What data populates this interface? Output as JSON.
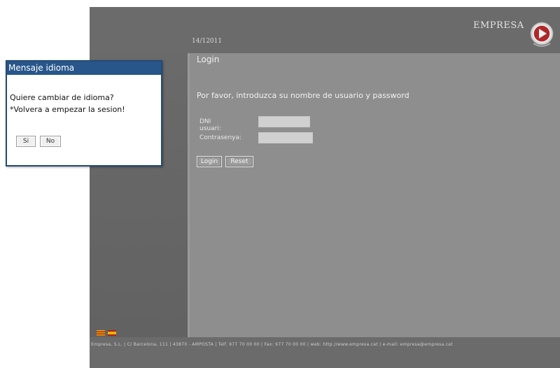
{
  "header": {
    "date": "14/12011",
    "brand": "EMPRESA"
  },
  "login": {
    "title": "Login",
    "instructions": "Por favor, introduzca su nombre de usuario y password",
    "user_label": "DNI usuari:",
    "user_value": "",
    "password_label": "Contrasenya:",
    "password_value": "",
    "login_button": "Login",
    "reset_button": "Reset"
  },
  "footer": {
    "text": "Empresa, S.L. | C/ Barcelona, 111 | 43870 - AMPOSTA | Telf. 977 70 00 00 | Fax: 977 70 00 00 | web: http://www.empresa.cat | e-mail: empresa@empresa.cat"
  },
  "dialog": {
    "title": "Mensaje idioma",
    "question": "Quiere cambiar de idioma?",
    "warning": "*Volvera a empezar la sesion!",
    "yes_button": "Si",
    "no_button": "No"
  },
  "colors": {
    "dialog_title_bg": "#28568a",
    "main_panel_bg": "#8e8e8e",
    "frame_bg": "#6b6b6b"
  },
  "icons": {
    "logo": "red-play-circle-logo",
    "flags": [
      "catalan-flag-icon",
      "spanish-flag-icon"
    ]
  }
}
